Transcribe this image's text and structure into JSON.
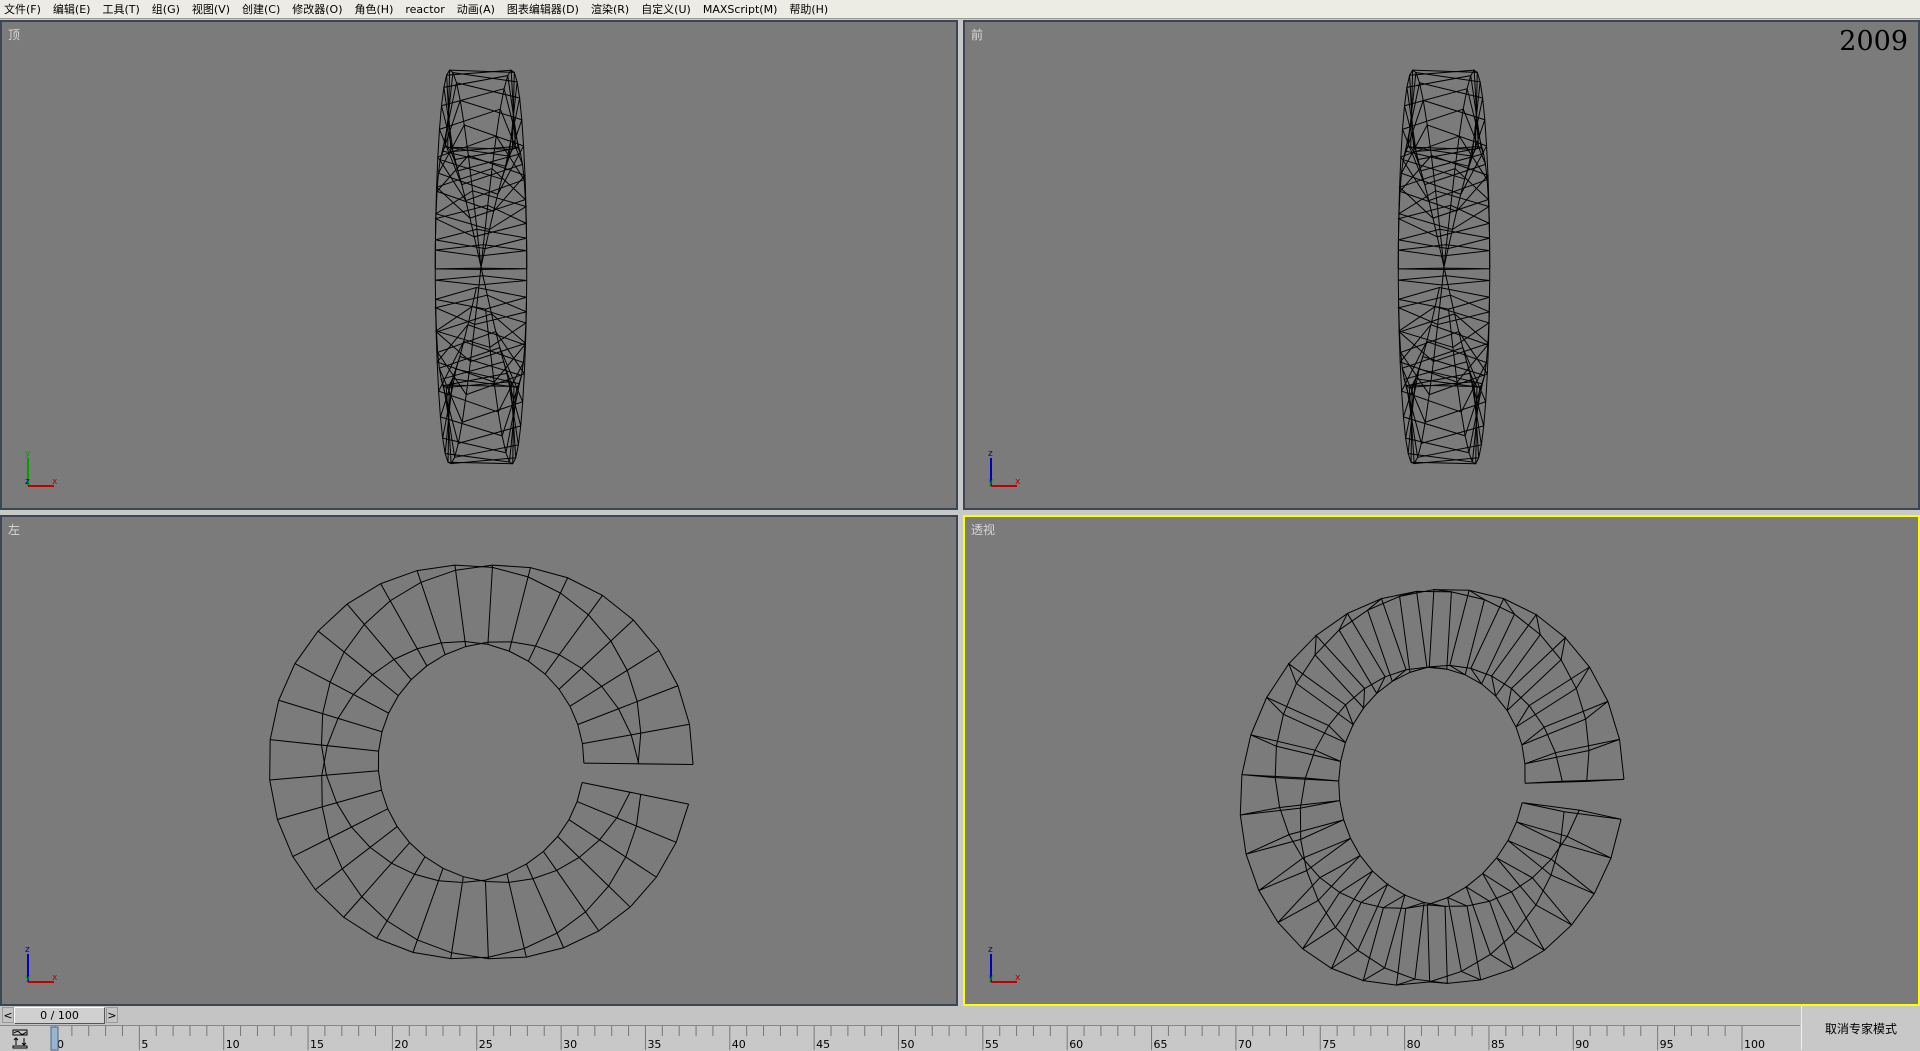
{
  "menu": [
    "文件(F)",
    "编辑(E)",
    "工具(T)",
    "组(G)",
    "视图(V)",
    "创建(C)",
    "修改器(O)",
    "角色(H)",
    "reactor",
    "动画(A)",
    "图表编辑器(D)",
    "渲染(R)",
    "自定义(U)",
    "MAXScript(M)",
    "帮助(H)"
  ],
  "viewports": {
    "top": {
      "label": "顶",
      "axes": [
        "y",
        "z",
        "x"
      ]
    },
    "front": {
      "label": "前",
      "axes": [
        "z",
        "y",
        "x"
      ],
      "overlay": "2009"
    },
    "left": {
      "label": "左",
      "axes": [
        "z",
        "y",
        "x"
      ]
    },
    "perspective": {
      "label": "透视",
      "axes": [
        "z",
        "y",
        "x"
      ],
      "active": true
    }
  },
  "timeline": {
    "current": "0 / 100",
    "prev": "<",
    "next": ">",
    "start": 0,
    "end": 100,
    "frame": 0,
    "labels": [
      "0",
      "5",
      "10",
      "15",
      "20",
      "25",
      "30",
      "35",
      "40",
      "45",
      "50",
      "55",
      "60",
      "65",
      "70",
      "75",
      "80",
      "85",
      "90",
      "95",
      "100"
    ]
  },
  "expert_mode_button": "取消专家模式",
  "colors": {
    "viewport_bg": "#7b7b7b",
    "active_border": "#ffff00",
    "axis_x": "#c00000",
    "axis_y": "#00a000",
    "axis_z": "#0000c0"
  }
}
